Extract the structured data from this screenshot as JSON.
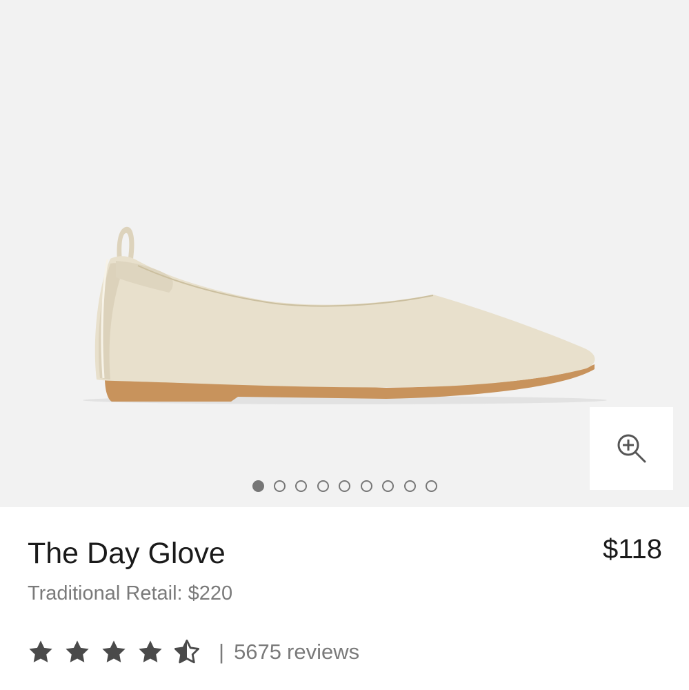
{
  "product": {
    "name": "The Day Glove",
    "price": "$118",
    "traditional_retail_label": "Traditional Retail:",
    "traditional_retail_price": "$220"
  },
  "gallery": {
    "image_count": 9,
    "active_index": 0,
    "zoom_icon": "zoom-in-icon"
  },
  "rating": {
    "stars": 4.5,
    "max_stars": 5,
    "separator": "|",
    "review_count": "5675",
    "review_word": "reviews"
  },
  "colors": {
    "hero_background": "#f2f2f2",
    "text_primary": "#1a1a1a",
    "text_secondary": "#7a7a7a",
    "star": "#4a4a4a",
    "dot": "#777777"
  }
}
